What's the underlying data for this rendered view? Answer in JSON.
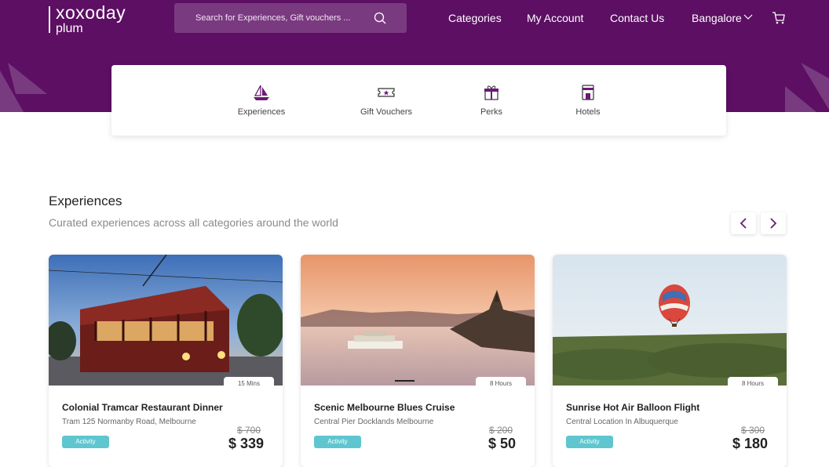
{
  "header": {
    "logo": {
      "brand": "xoxoday",
      "sub": "plum"
    },
    "search": {
      "placeholder": "Search for Experiences, Gift vouchers ..."
    },
    "nav": {
      "categories": "Categories",
      "account": "My Account",
      "contact": "Contact Us",
      "city": "Bangalore"
    }
  },
  "categories": [
    {
      "label": "Experiences",
      "icon": "sailboat-icon"
    },
    {
      "label": "Gift Vouchers",
      "icon": "voucher-icon"
    },
    {
      "label": "Perks",
      "icon": "gift-icon"
    },
    {
      "label": "Hotels",
      "icon": "hotel-icon"
    }
  ],
  "section": {
    "title": "Experiences",
    "subtitle": "Curated experiences across all categories around the world"
  },
  "cards": [
    {
      "title": "Colonial Tramcar Restaurant Dinner",
      "location": "Tram 125 Normanby Road, Melbourne",
      "badge": "Activity",
      "duration": "15 Mins",
      "old_price": "$ 700",
      "price": "$ 339"
    },
    {
      "title": "Scenic Melbourne Blues Cruise",
      "location": "Central Pier Docklands Melbourne",
      "badge": "Activity",
      "duration": "8 Hours",
      "old_price": "$ 200",
      "price": "$ 50"
    },
    {
      "title": "Sunrise Hot Air Balloon Flight",
      "location": "Central Location In Albuquerque",
      "badge": "Activity",
      "duration": "8 Hours",
      "old_price": "$ 300",
      "price": "$ 180"
    }
  ],
  "colors": {
    "header_bg": "#5c0f63",
    "accent": "#6a1b72",
    "badge": "#5fc6cf"
  }
}
